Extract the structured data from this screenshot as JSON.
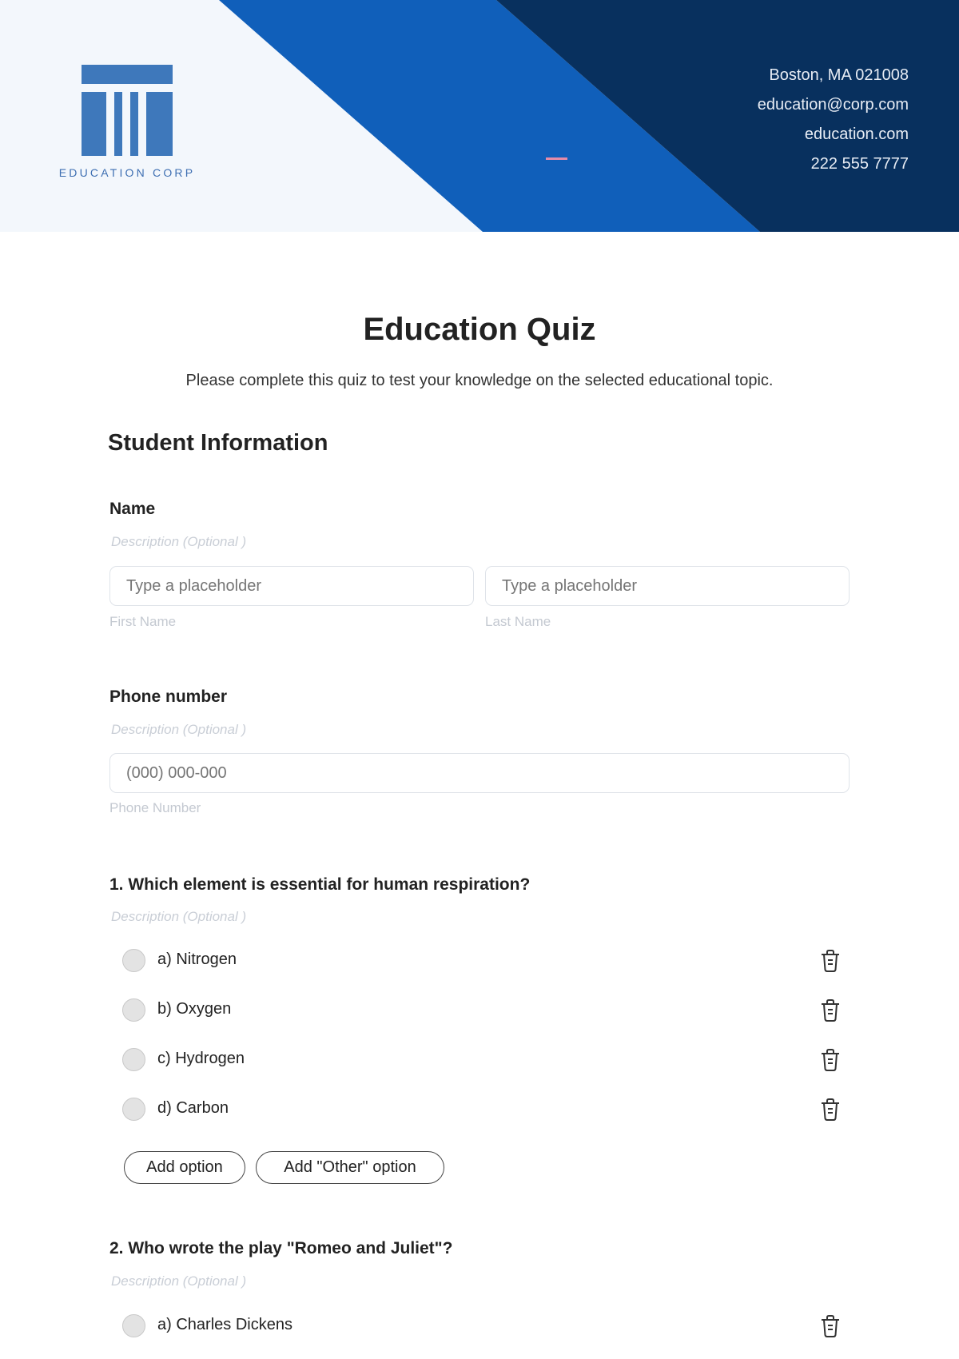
{
  "header": {
    "logo_text": "EDUCATION CORP",
    "contact": {
      "address": "Boston, MA 021008",
      "email": "education@corp.com",
      "website": "education.com",
      "phone": "222 555 7777"
    },
    "colors": {
      "light_bg": "#f3f7fc",
      "bright_blue": "#105fba",
      "navy": "#08305e",
      "logo_blue": "#3e78bb",
      "accent_pink": "#e58ba8"
    }
  },
  "form": {
    "title": "Education Quiz",
    "subtitle": "Please complete this quiz to test your knowledge on the selected educational topic.",
    "section_title": "Student Information",
    "name": {
      "label": "Name",
      "description": "Description (Optional )",
      "first": {
        "placeholder": "Type a placeholder",
        "sublabel": "First Name"
      },
      "last": {
        "placeholder": "Type a placeholder",
        "sublabel": "Last Name"
      }
    },
    "phone": {
      "label": "Phone number",
      "description": "Description (Optional )",
      "placeholder": "(000) 000-000",
      "sublabel": "Phone Number"
    },
    "questions": [
      {
        "label": "1. Which element is essential for human respiration?",
        "description": "Description (Optional )",
        "options": [
          "a) Nitrogen",
          "b) Oxygen",
          "c) Hydrogen",
          "d) Carbon"
        ],
        "add_option": "Add option",
        "add_other": "Add \"Other\" option"
      },
      {
        "label": "2. Who wrote the play \"Romeo and Juliet\"?",
        "description": "Description (Optional )",
        "options": [
          "a) Charles Dickens"
        ]
      }
    ]
  }
}
